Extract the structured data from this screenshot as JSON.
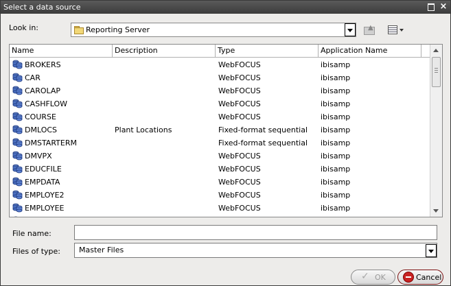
{
  "window": {
    "title": "Select a data source"
  },
  "lookin": {
    "label": "Look in:",
    "value": "Reporting Server"
  },
  "columns": [
    "Name",
    "Description",
    "Type",
    "Application Name"
  ],
  "rows": [
    {
      "name": "BROKERS",
      "desc": "",
      "type": "WebFOCUS",
      "app": "ibisamp"
    },
    {
      "name": "CAR",
      "desc": "",
      "type": "WebFOCUS",
      "app": "ibisamp"
    },
    {
      "name": "CAROLAP",
      "desc": "",
      "type": "WebFOCUS",
      "app": "ibisamp"
    },
    {
      "name": "CASHFLOW",
      "desc": "",
      "type": "WebFOCUS",
      "app": "ibisamp"
    },
    {
      "name": "COURSE",
      "desc": "",
      "type": "WebFOCUS",
      "app": "ibisamp"
    },
    {
      "name": "DMLOCS",
      "desc": "Plant Locations",
      "type": "Fixed-format sequential",
      "app": "ibisamp"
    },
    {
      "name": "DMSTARTERM",
      "desc": "",
      "type": "Fixed-format sequential",
      "app": "ibisamp"
    },
    {
      "name": "DMVPX",
      "desc": "",
      "type": "WebFOCUS",
      "app": "ibisamp"
    },
    {
      "name": "EDUCFILE",
      "desc": "",
      "type": "WebFOCUS",
      "app": "ibisamp"
    },
    {
      "name": "EMPDATA",
      "desc": "",
      "type": "WebFOCUS",
      "app": "ibisamp"
    },
    {
      "name": "EMPLOYE2",
      "desc": "",
      "type": "WebFOCUS",
      "app": "ibisamp"
    },
    {
      "name": "EMPLOYEE",
      "desc": "",
      "type": "WebFOCUS",
      "app": "ibisamp"
    }
  ],
  "filename": {
    "label": "File name:",
    "value": ""
  },
  "filetype": {
    "label": "Files of type:",
    "value": "Master Files"
  },
  "buttons": {
    "ok": "OK",
    "cancel": "Cancel"
  },
  "icons": {
    "row_icon": "data-cube-icon",
    "folder": "folder-icon"
  },
  "colors": {
    "titlebar": "#4a4a4a",
    "cancel_accent": "#c92222"
  }
}
